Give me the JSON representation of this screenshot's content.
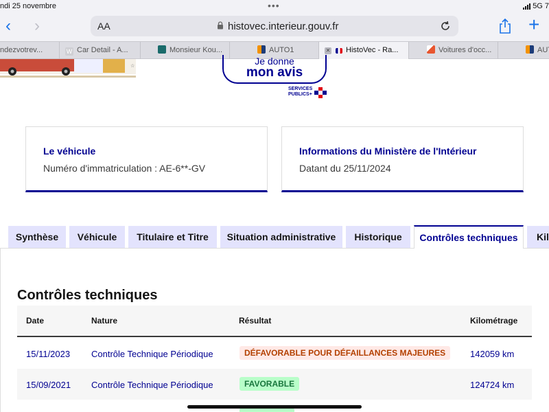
{
  "status": {
    "date": "ndi 25 novembre",
    "network": "5G",
    "battery": "7"
  },
  "browser": {
    "aa": "AA",
    "url": "histovec.interieur.gouv.fr",
    "tabs": [
      {
        "label": "ndezvotrev...",
        "favicon_color": "#dcdce2"
      },
      {
        "label": "Car Detail - A...",
        "favicon_color": "#cfcfd4"
      },
      {
        "label": "Monsieur Kou...",
        "favicon_color": "#1a6b6b"
      },
      {
        "label": "AUTO1",
        "favicon_color": "#f39200"
      },
      {
        "label": "HistoVec - Ra...",
        "favicon_color": "#000091"
      },
      {
        "label": "Voitures d'occ...",
        "favicon_color": "#e8552f"
      },
      {
        "label": "AUT",
        "favicon_color": "#f39200"
      }
    ]
  },
  "banner": {
    "avis_line1": "Je donne",
    "avis_line2": "mon avis",
    "sp_line1": "SERVICES",
    "sp_line2": "PUBLICS+"
  },
  "cards": {
    "vehicle": {
      "title": "Le véhicule",
      "value": "Numéro d'immatriculation : AE-6**-GV"
    },
    "ministry": {
      "title": "Informations du Ministère de l'Intérieur",
      "value": "Datant du 25/11/2024"
    }
  },
  "page_tabs": [
    "Synthèse",
    "Véhicule",
    "Titulaire et Titre",
    "Situation administrative",
    "Historique",
    "Contrôles techniques",
    "Kilo"
  ],
  "section_title": "Contrôles techniques",
  "table": {
    "headers": [
      "Date",
      "Nature",
      "Résultat",
      "Kilométrage"
    ],
    "rows": [
      {
        "date": "15/11/2023",
        "nature": "Contrôle Technique Périodique",
        "result": "DÉFAVORABLE POUR DÉFAILLANCES MAJEURES",
        "km": "142059 km"
      },
      {
        "date": "15/09/2021",
        "nature": "Contrôle Technique Périodique",
        "result": "FAVORABLE",
        "km": "124724 km"
      }
    ]
  },
  "colors": {
    "accent": "#000091",
    "unfavorable_bg": "#ffe9e6",
    "unfavorable_text": "#b34000",
    "favorable_bg": "#b8fec9",
    "favorable_text": "#18753c"
  }
}
